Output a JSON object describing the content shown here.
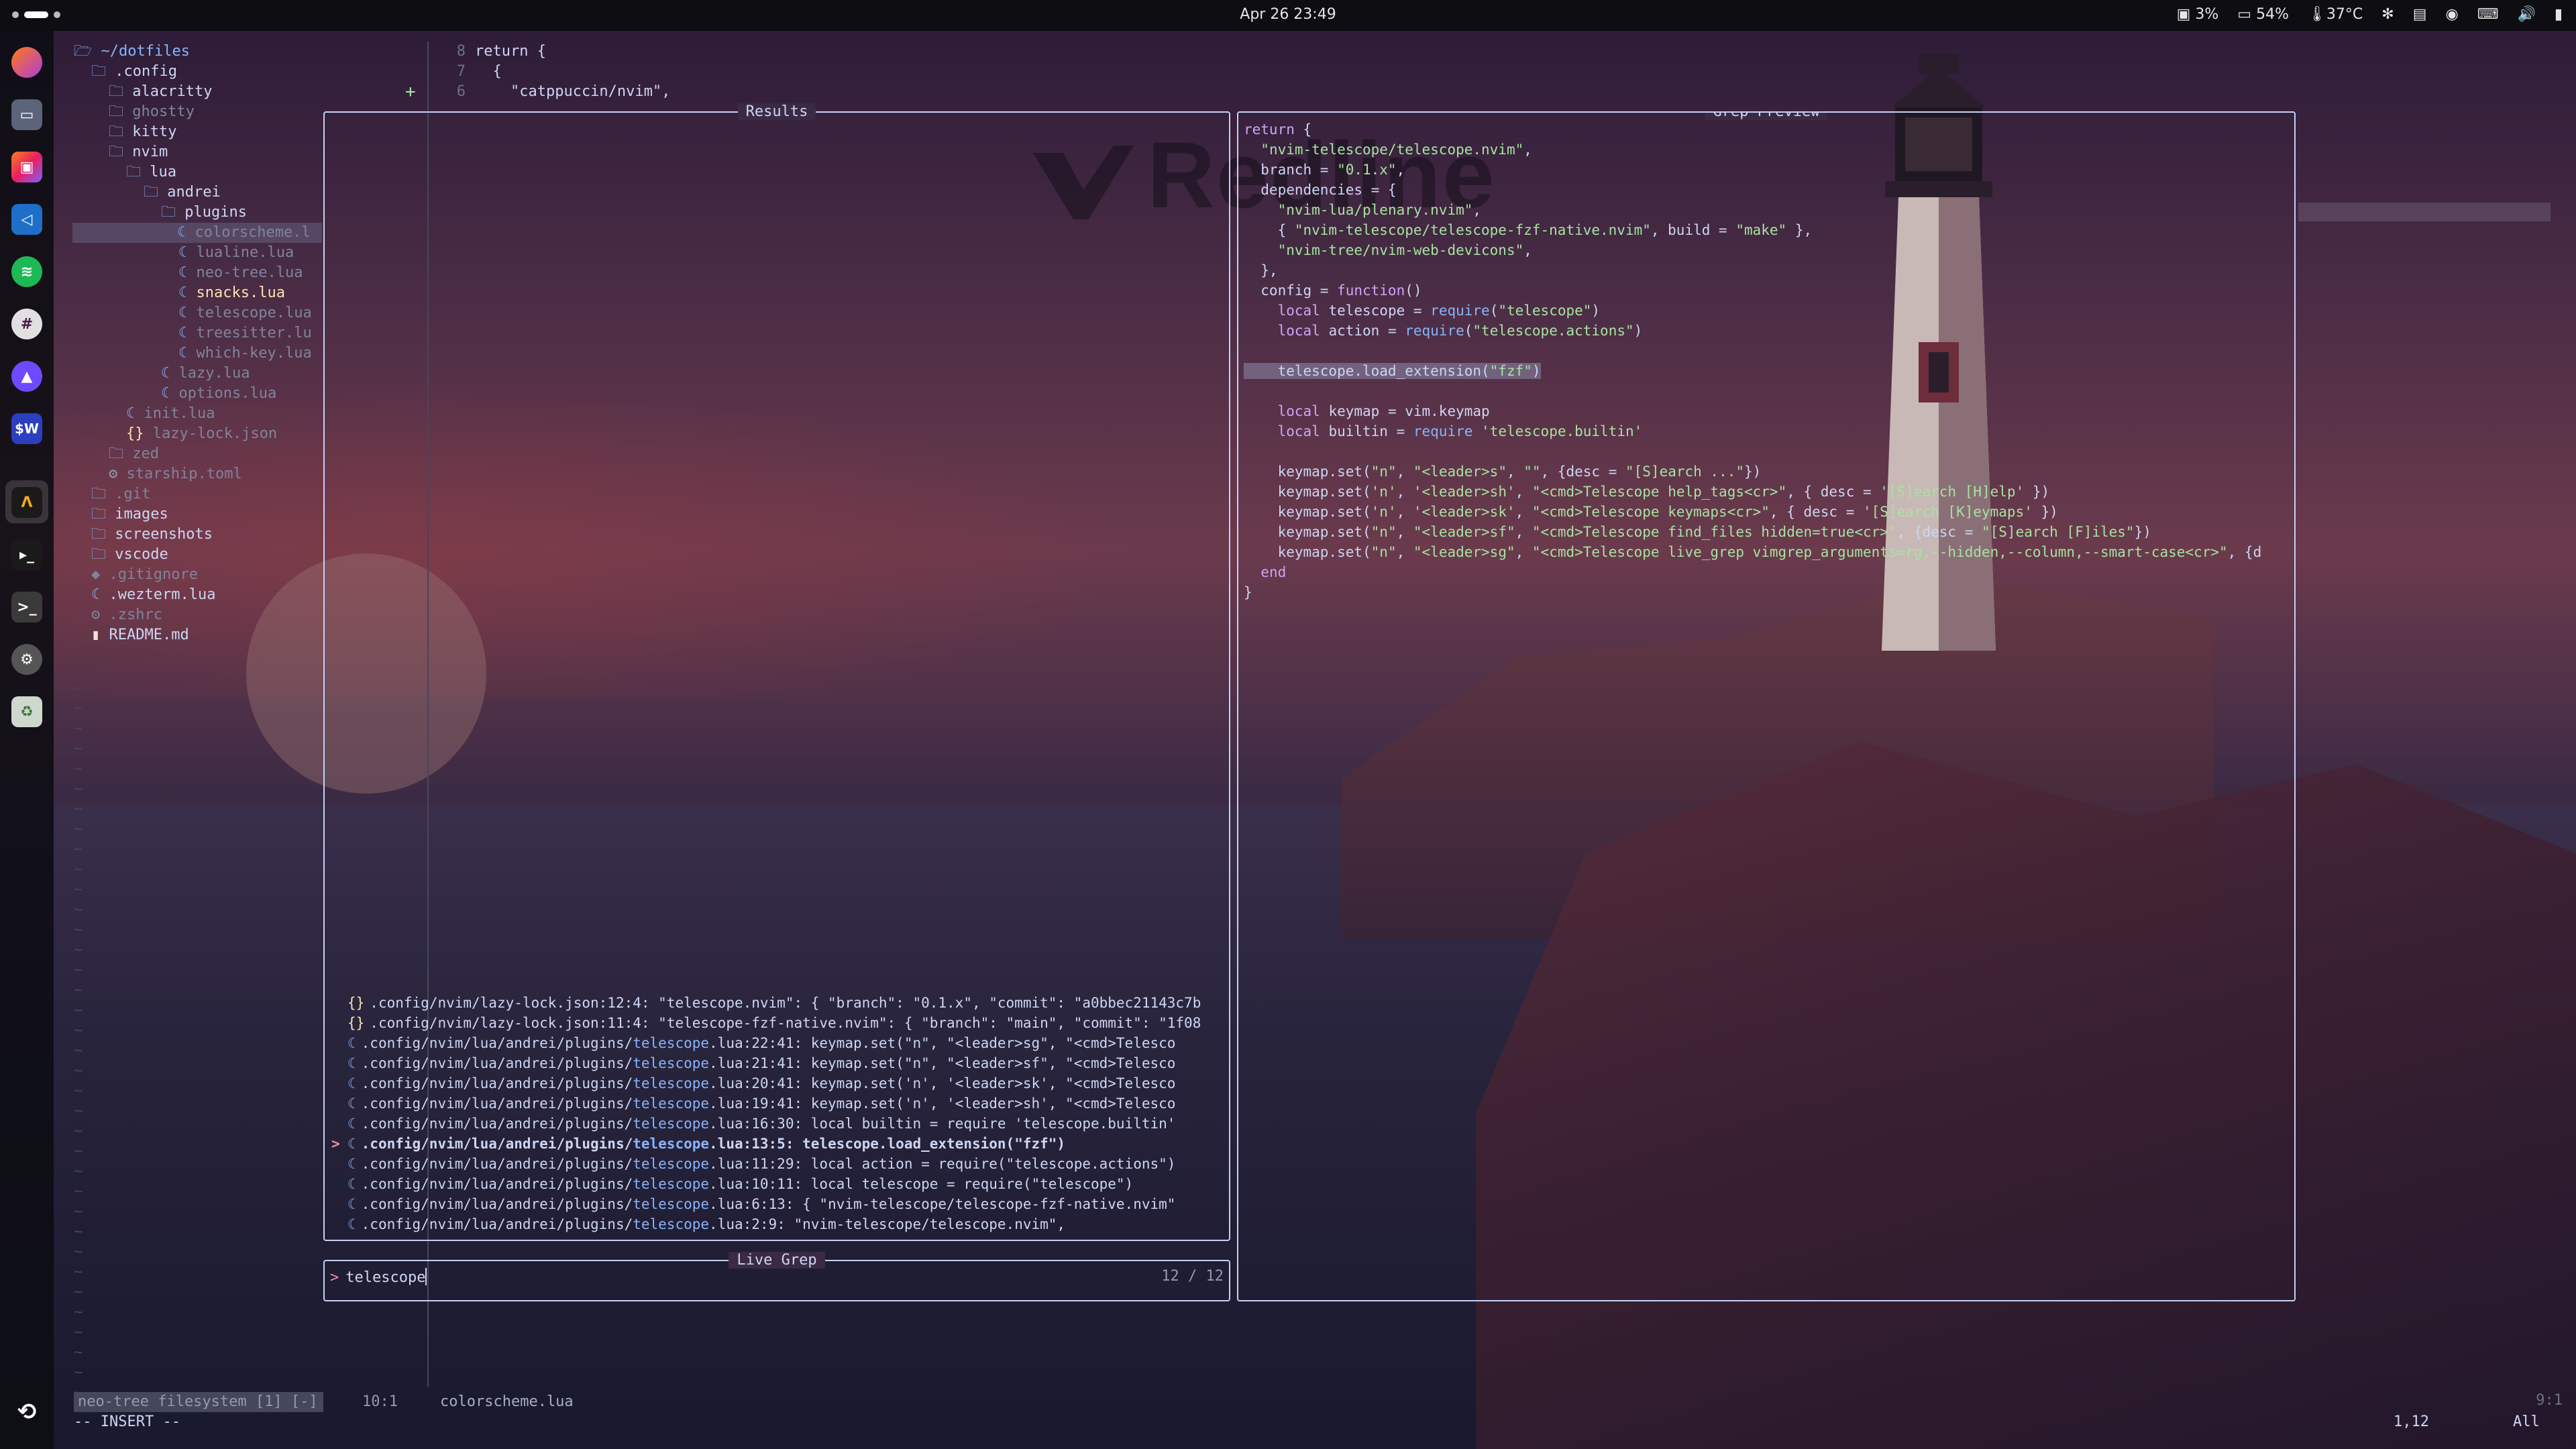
{
  "topbar": {
    "clock": "Apr 26  23:49",
    "disk": "3%",
    "battery": "54%",
    "temp": "37°C"
  },
  "dock": {
    "apps": [
      "firefox",
      "files",
      "jetbrains-toolbox",
      "vscode",
      "spotify",
      "slack",
      "proton-vpn",
      "warp-terminal",
      "alacritty",
      "terminal",
      "terminal-2",
      "settings",
      "trash"
    ],
    "sw_label": "$W"
  },
  "tree": {
    "root": "~/dotfiles",
    "items": [
      {
        "label": ".config",
        "icon": "folder",
        "level": 1
      },
      {
        "label": "alacritty",
        "icon": "folder",
        "level": 2
      },
      {
        "label": "ghostty",
        "icon": "folder",
        "level": 2,
        "dim": true
      },
      {
        "label": "kitty",
        "icon": "folder",
        "level": 2
      },
      {
        "label": "nvim",
        "icon": "folder",
        "level": 2
      },
      {
        "label": "lua",
        "icon": "folder",
        "level": 3
      },
      {
        "label": "andrei",
        "icon": "folder",
        "level": 4
      },
      {
        "label": "plugins",
        "icon": "folder",
        "level": 5
      },
      {
        "label": "colorscheme.l",
        "icon": "lua",
        "level": 6,
        "selected": true,
        "dim": true
      },
      {
        "label": "lualine.lua",
        "icon": "lua",
        "level": 6,
        "dim": true
      },
      {
        "label": "neo-tree.lua",
        "icon": "lua",
        "level": 6,
        "dim": true
      },
      {
        "label": "snacks.lua",
        "icon": "lua",
        "level": 6,
        "highlight": true
      },
      {
        "label": "telescope.lua",
        "icon": "lua",
        "level": 6,
        "dim": true
      },
      {
        "label": "treesitter.lu",
        "icon": "lua",
        "level": 6,
        "dim": true
      },
      {
        "label": "which-key.lua",
        "icon": "lua",
        "level": 6,
        "dim": true
      },
      {
        "label": "lazy.lua",
        "icon": "lua",
        "level": 5,
        "dim": true
      },
      {
        "label": "options.lua",
        "icon": "lua",
        "level": 5,
        "dim": true
      },
      {
        "label": "init.lua",
        "icon": "lua",
        "level": 3,
        "dim": true
      },
      {
        "label": "lazy-lock.json",
        "icon": "json",
        "level": 3,
        "dim": true
      },
      {
        "label": "zed",
        "icon": "folder",
        "level": 2,
        "dim": true
      },
      {
        "label": "starship.toml",
        "icon": "toml",
        "level": 2,
        "dim": true
      },
      {
        "label": ".git",
        "icon": "folder",
        "level": 1,
        "dim": true
      },
      {
        "label": "images",
        "icon": "folder",
        "level": 1
      },
      {
        "label": "screenshots",
        "icon": "folder",
        "level": 1
      },
      {
        "label": "vscode",
        "icon": "folder",
        "level": 1
      },
      {
        "label": ".gitignore",
        "icon": "git",
        "level": 1,
        "dim": true
      },
      {
        "label": ".wezterm.lua",
        "icon": "lua",
        "level": 1
      },
      {
        "label": ".zshrc",
        "icon": "gear",
        "level": 1,
        "dim": true
      },
      {
        "label": "README.md",
        "icon": "md",
        "level": 1
      }
    ]
  },
  "editor": {
    "lines": [
      {
        "num": "8",
        "text": "return {"
      },
      {
        "num": "7",
        "text": "  {"
      },
      {
        "num": "6",
        "text": "    \"catppuccin/nvim\","
      }
    ]
  },
  "telescope": {
    "results_title": "Results",
    "preview_title": "Grep Preview",
    "prompt_title": "Live Grep",
    "prompt_prefix": ">",
    "query": "telescope",
    "counter": "12 / 12",
    "results": [
      {
        "icon": "{}",
        "file": ".config/nvim/lazy-lock.json:12:4:",
        "text": "  \"telescope.nvim\": { \"branch\": \"0.1.x\", \"commit\": \"a0bbec21143c7b"
      },
      {
        "icon": "{}",
        "file": ".config/nvim/lazy-lock.json:11:4:",
        "text": "  \"telescope-fzf-native.nvim\": { \"branch\": \"main\", \"commit\": \"1f08"
      },
      {
        "icon": "lua",
        "file": ".config/nvim/lua/andrei/plugins/telescope.lua:22:41:",
        "text": "    keymap.set(\"n\", \"<leader>sg\", \"<cmd>Telesco"
      },
      {
        "icon": "lua",
        "file": ".config/nvim/lua/andrei/plugins/telescope.lua:21:41:",
        "text": "    keymap.set(\"n\", \"<leader>sf\", \"<cmd>Telesco"
      },
      {
        "icon": "lua",
        "file": ".config/nvim/lua/andrei/plugins/telescope.lua:20:41:",
        "text": "    keymap.set('n', '<leader>sk', \"<cmd>Telesco"
      },
      {
        "icon": "lua",
        "file": ".config/nvim/lua/andrei/plugins/telescope.lua:19:41:",
        "text": "    keymap.set('n', '<leader>sh', \"<cmd>Telesco"
      },
      {
        "icon": "lua",
        "file": ".config/nvim/lua/andrei/plugins/telescope.lua:16:30:",
        "text": "    local builtin = require 'telescope.builtin'"
      },
      {
        "icon": "lua",
        "file": ".config/nvim/lua/andrei/plugins/telescope.lua:13:5:",
        "text": "    telescope.load_extension(\"fzf\")",
        "selected": true
      },
      {
        "icon": "lua",
        "file": ".config/nvim/lua/andrei/plugins/telescope.lua:11:29:",
        "text": "    local action = require(\"telescope.actions\")"
      },
      {
        "icon": "lua",
        "file": ".config/nvim/lua/andrei/plugins/telescope.lua:10:11:",
        "text": "    local telescope = require(\"telescope\")"
      },
      {
        "icon": "lua",
        "file": ".config/nvim/lua/andrei/plugins/telescope.lua:6:13:",
        "text": "    { \"nvim-telescope/telescope-fzf-native.nvim\""
      },
      {
        "icon": "lua",
        "file": ".config/nvim/lua/andrei/plugins/telescope.lua:2:9:",
        "text": "  \"nvim-telescope/telescope.nvim\","
      }
    ],
    "preview_lines": [
      "return {",
      "  \"nvim-telescope/telescope.nvim\",",
      "  branch = \"0.1.x\",",
      "  dependencies = {",
      "    \"nvim-lua/plenary.nvim\",",
      "    { \"nvim-telescope/telescope-fzf-native.nvim\", build = \"make\" },",
      "    \"nvim-tree/nvim-web-devicons\",",
      "  },",
      "  config = function()",
      "    local telescope = require(\"telescope\")",
      "    local action = require(\"telescope.actions\")",
      "",
      "    telescope.load_extension(\"fzf\")",
      "",
      "    local keymap = vim.keymap",
      "    local builtin = require 'telescope.builtin'",
      "",
      "    keymap.set(\"n\", \"<leader>s\", \"\", {desc = \"[S]earch ...\"})",
      "    keymap.set('n', '<leader>sh', \"<cmd>Telescope help_tags<cr>\", { desc = '[S]earch [H]elp' })",
      "    keymap.set('n', '<leader>sk', \"<cmd>Telescope keymaps<cr>\", { desc = '[S]earch [K]eymaps' })",
      "    keymap.set(\"n\", \"<leader>sf\", \"<cmd>Telescope find_files hidden=true<cr>\", {desc = \"[S]earch [F]iles\"})",
      "    keymap.set(\"n\", \"<leader>sg\", \"<cmd>Telescope live_grep vimgrep_arguments=rg,--hidden,--column,--smart-case<cr>\", {d",
      "  end",
      "}"
    ],
    "preview_highlight_index": 12
  },
  "statusline": {
    "left": "neo-tree filesystem [1] [-]",
    "pos": "10:1",
    "file": "colorscheme.lua",
    "right": "9:1"
  },
  "cmdline": {
    "mode": "-- INSERT --",
    "cursor": "1,12",
    "scroll": "All"
  },
  "brand": "Redline"
}
